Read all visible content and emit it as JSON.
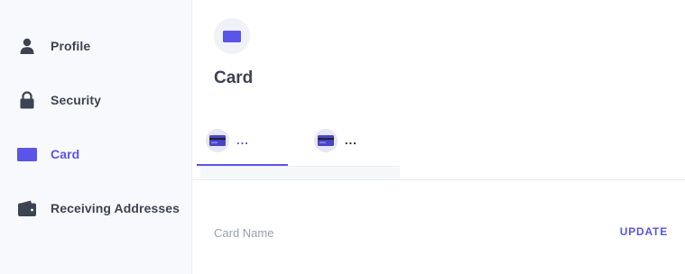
{
  "sidebar": {
    "items": [
      {
        "label": "Profile",
        "icon": "person-icon",
        "active": false
      },
      {
        "label": "Security",
        "icon": "lock-icon",
        "active": false
      },
      {
        "label": "Card",
        "icon": "card-icon",
        "active": true
      },
      {
        "label": "Receiving Addresses",
        "icon": "wallet-icon",
        "active": false
      }
    ]
  },
  "main": {
    "header_icon": "card-icon",
    "title": "Card",
    "tabs": [
      {
        "label": "...",
        "icon": "credit-card-icon",
        "selected": true
      },
      {
        "label": "...",
        "icon": "credit-card-icon",
        "selected": false
      }
    ],
    "field_label": "Card Name",
    "update_label": "UPDATE"
  },
  "colors": {
    "accent": "#5b54e8",
    "text": "#3d4451",
    "muted": "#9aa0ab",
    "sidebar_bg": "#f8f9fd"
  }
}
